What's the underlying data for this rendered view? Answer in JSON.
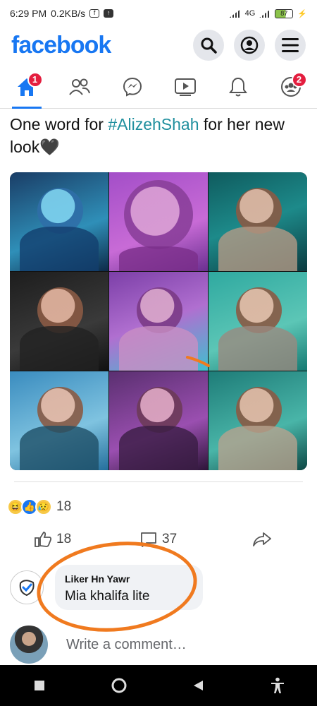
{
  "status_bar": {
    "time": "6:29 PM",
    "speed": "0.2KB/s",
    "battery": "87",
    "network": "4G"
  },
  "header": {
    "logo": "facebook",
    "brand_color": "#1877f2"
  },
  "nav": {
    "home_badge": "1",
    "menu_badge": "2"
  },
  "post": {
    "text_before": "One word for ",
    "hashtag": "#AlizehShah",
    "text_after": " for her new look",
    "emoji": "🖤",
    "reaction_count": "18",
    "like_count": "18",
    "comment_count": "37"
  },
  "comment": {
    "author": "Liker Hn Yawr",
    "text": "Mia khalifa lite"
  },
  "composer": {
    "placeholder": "Write a comment…"
  },
  "colors": {
    "accent": "#1877f2",
    "badge": "#e41e3f",
    "annotation": "#f07a1f",
    "hashtag": "#1f8f9e"
  }
}
